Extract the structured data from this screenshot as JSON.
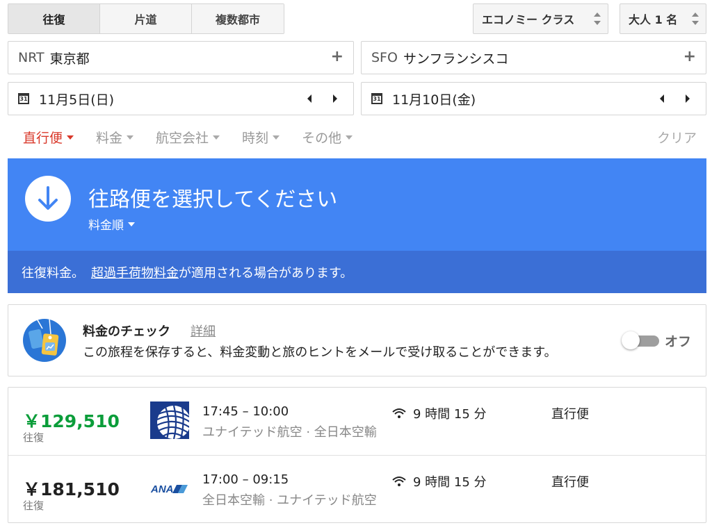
{
  "trip_types": [
    {
      "label": "往復",
      "active": true
    },
    {
      "label": "片道",
      "active": false
    },
    {
      "label": "複数都市",
      "active": false
    }
  ],
  "cabin": {
    "label": "エコノミー クラス"
  },
  "passengers": {
    "label": "大人 1 名"
  },
  "origin": {
    "code": "NRT",
    "name": "東京都",
    "add": "+"
  },
  "destination": {
    "code": "SFO",
    "name": "サンフランシスコ",
    "add": "+"
  },
  "depart_date": {
    "icon_text": "31",
    "value": "11月5日(日)"
  },
  "return_date": {
    "icon_text": "31",
    "value": "11月10日(金)"
  },
  "filters": [
    {
      "label": "直行便",
      "active": true
    },
    {
      "label": "料金",
      "active": false
    },
    {
      "label": "航空会社",
      "active": false
    },
    {
      "label": "時刻",
      "active": false
    },
    {
      "label": "その他",
      "active": false
    }
  ],
  "clear_label": "クリア",
  "banner": {
    "title": "往路便を選択してください",
    "sort_label": "料金順",
    "notice_text": "往復料金。",
    "notice_link": "超過手荷物料金",
    "notice_suffix": "が適用される場合があります。"
  },
  "tracking": {
    "title": "料金のチェック",
    "detail_link": "詳細",
    "description": "この旅程を保存すると、料金変動と旅のヒントをメールで受け取ることができます。",
    "toggle_label": "オフ",
    "toggle_on": false
  },
  "results": [
    {
      "price": "￥129,510",
      "price_type": "往復",
      "highlight": true,
      "logo": "united-logo",
      "times": "17:45 – 10:00",
      "airlines": "ユナイテッド航空 · 全日本空輸",
      "duration": "9 時間 15 分",
      "stops": "直行便"
    },
    {
      "price": "￥181,510",
      "price_type": "往復",
      "highlight": false,
      "logo": "ana-logo",
      "logo_text": "ANA",
      "times": "17:00 – 09:15",
      "airlines": "全日本空輸 · ユナイテッド航空",
      "duration": "9 時間 15 分",
      "stops": "直行便"
    }
  ],
  "colors": {
    "accent_red": "#d9382a",
    "banner_blue": "#4285f4",
    "notice_blue": "#3b6fd6",
    "price_green": "#0b9d3a"
  }
}
